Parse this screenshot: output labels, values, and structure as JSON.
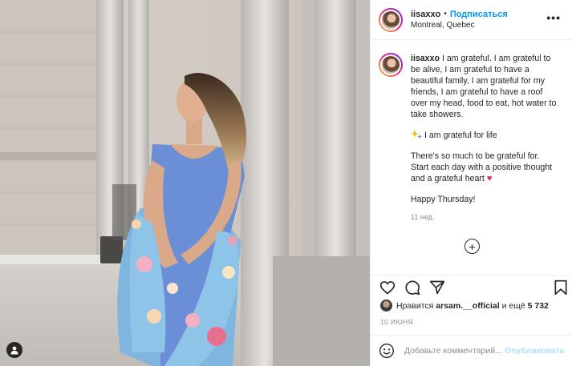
{
  "post": {
    "username": "iisaxxo",
    "separator": "•",
    "follow_label": "Подписаться",
    "location": "Montreal, Quebec",
    "more_label": "•••"
  },
  "caption": {
    "username": "iisaxxo",
    "paragraph1": "I am grateful. I am grateful to be alive, I am grateful to have a beautiful family, I am grateful for my friends, I am grateful to have a roof over my head, food to eat, hot water to take showers.",
    "paragraph2": "I am grateful for life",
    "paragraph3": "There's so much to be grateful for. Start each day with a positive thought and a grateful heart",
    "paragraph4": "Happy Thursday!",
    "time_ago": "11 нед."
  },
  "load_more_label": "+",
  "likes": {
    "prefix": "Нравится",
    "liker": "arsam.__official",
    "and_more": "и ещё",
    "count": "5 732"
  },
  "post_date": "10 ИЮНЯ",
  "comment": {
    "placeholder": "Добавьте комментарий...",
    "publish_label": "Опубликовать"
  },
  "icons": {
    "like": "heart-outline-icon",
    "comment": "speech-bubble-icon",
    "share": "paper-plane-icon",
    "save": "bookmark-icon",
    "emoji": "smiley-icon",
    "user_tags": "person-icon",
    "more": "ellipsis-icon"
  },
  "colors": {
    "link_blue": "#0095f6",
    "publish_disabled": "#b2dffc",
    "secondary_text": "#8e8e8e",
    "heart_red": "#e0245e"
  }
}
